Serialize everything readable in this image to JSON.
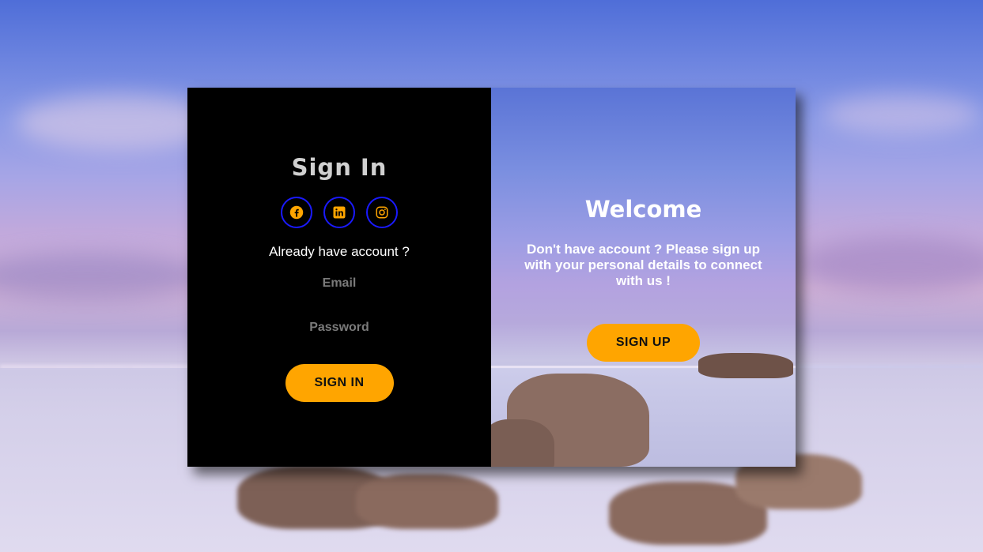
{
  "signin": {
    "title": "Sign In",
    "socials": [
      {
        "name": "facebook-icon",
        "color": "#ffa500"
      },
      {
        "name": "linkedin-icon",
        "color": "#ffa500"
      },
      {
        "name": "instagram-icon",
        "color": "#ffa500"
      }
    ],
    "subtitle": "Already have account ?",
    "email_placeholder": "Email",
    "password_placeholder": "Password",
    "button_label": "SIGN IN"
  },
  "signup": {
    "title": "Welcome",
    "description": "Don't have account ? Please sign up with your personal details to connect with us !",
    "button_label": "SIGN UP"
  },
  "colors": {
    "accent": "#ffa500",
    "social_border": "#1a1aff",
    "panel_left_bg": "#000000"
  }
}
